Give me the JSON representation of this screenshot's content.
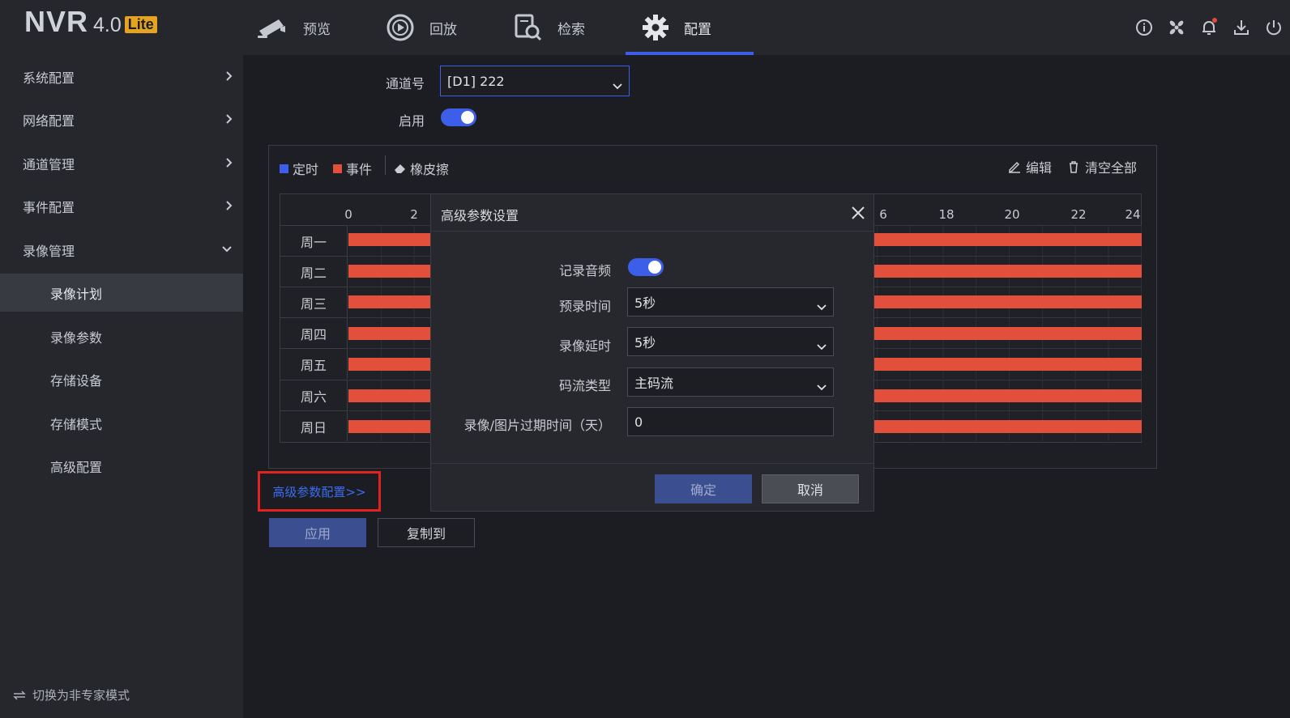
{
  "logo": {
    "name": "NVR",
    "version": "4.0",
    "edition": "Lite"
  },
  "nav": [
    {
      "label": "预览",
      "icon": "camera-icon"
    },
    {
      "label": "回放",
      "icon": "playback-icon"
    },
    {
      "label": "检索",
      "icon": "search-file-icon"
    },
    {
      "label": "配置",
      "icon": "gear-icon",
      "active": true
    }
  ],
  "top_icons": [
    "info-icon",
    "fan-icon",
    "bell-icon",
    "download-icon",
    "power-icon"
  ],
  "sidebar": {
    "items": [
      {
        "label": "系统配置"
      },
      {
        "label": "网络配置"
      },
      {
        "label": "通道管理"
      },
      {
        "label": "事件配置"
      },
      {
        "label": "录像管理",
        "expanded": true
      }
    ],
    "sub_items": [
      {
        "label": "录像计划",
        "active": true
      },
      {
        "label": "录像参数"
      },
      {
        "label": "存储设备"
      },
      {
        "label": "存储模式"
      },
      {
        "label": "高级配置"
      }
    ],
    "footer": "切换为非专家模式"
  },
  "main": {
    "channel_label": "通道号",
    "channel_value": "[D1] 222",
    "enable_label": "启用",
    "legend": {
      "timed": "定时",
      "event": "事件",
      "eraser": "橡皮擦"
    },
    "tools": {
      "edit": "编辑",
      "clear_all": "清空全部"
    },
    "hours_visible_left": [
      "0",
      "2"
    ],
    "hours_visible_right": [
      "6",
      "18",
      "20",
      "22",
      "24"
    ],
    "days": [
      "周一",
      "周二",
      "周三",
      "周四",
      "周五",
      "周六",
      "周日"
    ],
    "advanced_link": "高级参数配置>>",
    "apply_button": "应用",
    "copy_button": "复制到"
  },
  "colors": {
    "accent": "#3d5ee8",
    "timed": "#3d5ee8",
    "event": "#e2503c",
    "highlight": "#e0231f"
  },
  "modal": {
    "title": "高级参数设置",
    "record_audio_label": "记录音频",
    "prerecord_label": "预录时间",
    "prerecord_value": "5秒",
    "postrecord_label": "录像延时",
    "postrecord_value": "5秒",
    "stream_label": "码流类型",
    "stream_value": "主码流",
    "expire_label": "录像/图片过期时间（天）",
    "expire_value": "0",
    "ok_button": "确定",
    "cancel_button": "取消"
  }
}
